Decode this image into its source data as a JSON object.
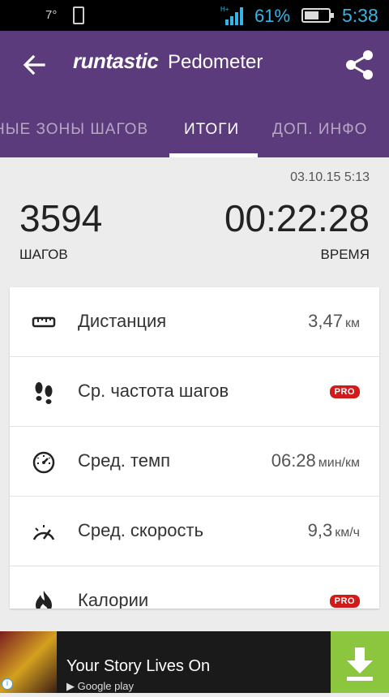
{
  "status_bar": {
    "temperature": "7°",
    "network": "H+",
    "battery_percent": "61%",
    "battery_level": 0.61,
    "time": "5:38"
  },
  "app_bar": {
    "brand": "runtastic",
    "product": "Pedometer",
    "back_icon": "arrow-left-icon",
    "share_icon": "share-icon"
  },
  "tabs": [
    {
      "label": "НЫЕ ЗОНЫ ШАГОВ",
      "active": false
    },
    {
      "label": "ИТОГИ",
      "active": true
    },
    {
      "label": "ДОП. ИНФО",
      "active": false
    }
  ],
  "summary": {
    "date": "03.10.15 5:13",
    "steps_value": "3594",
    "steps_label": "ШАГОВ",
    "time_value": "00:22:28",
    "time_label": "ВРЕМЯ"
  },
  "stats": [
    {
      "icon": "ruler-icon",
      "label": "Дистанция",
      "value": "3,47",
      "unit": "км"
    },
    {
      "icon": "footprints-icon",
      "label": "Ср. частота шагов",
      "pro": "PRO"
    },
    {
      "icon": "stopwatch-icon",
      "label": "Сред. темп",
      "value": "06:28",
      "unit": "мин/км"
    },
    {
      "icon": "speedometer-icon",
      "label": "Сред. скорость",
      "value": "9,3",
      "unit": "км/ч"
    },
    {
      "icon": "flame-icon",
      "label": "Калории",
      "pro": "PRO"
    }
  ],
  "ad": {
    "title": "Your Story Lives On",
    "store": "Google play",
    "info_icon": "info-icon",
    "download_icon": "download-icon"
  },
  "colors": {
    "app_bar": "#5b3b7c",
    "status_accent": "#35b5e5",
    "pro_badge": "#d11a1a",
    "download_button": "#8cc63f"
  }
}
